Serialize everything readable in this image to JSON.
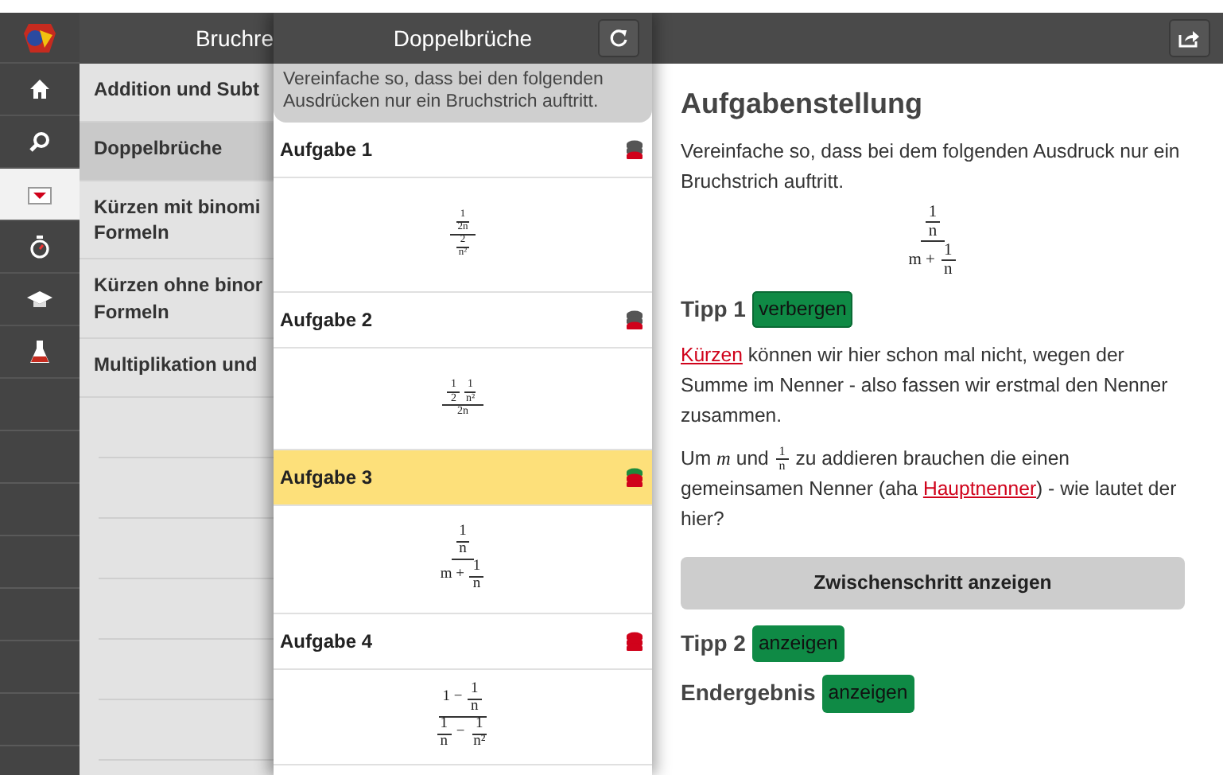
{
  "rail": [
    {
      "kind": "home",
      "selected": false
    },
    {
      "kind": "search",
      "selected": false
    },
    {
      "kind": "tray",
      "selected": true
    },
    {
      "kind": "stopwatch",
      "selected": false
    },
    {
      "kind": "cap",
      "selected": false
    },
    {
      "kind": "flask",
      "selected": false
    }
  ],
  "sidebar": {
    "title": "Bruchre",
    "items": [
      {
        "label": "Addition und Subt",
        "selected": false
      },
      {
        "label": "Doppelbrüche",
        "selected": true
      },
      {
        "label": "Kürzen mit binomi\nFormeln",
        "selected": false
      },
      {
        "label": "Kürzen ohne binor\nFormeln",
        "selected": false
      },
      {
        "label": "Multiplikation und",
        "selected": false
      }
    ]
  },
  "list_panel": {
    "title": "Doppelbrüche",
    "instruction": "Vereinfache so, dass bei den folgenden Ausdrücken nur ein Bruchstrich auftritt.",
    "items": [
      {
        "label": "Aufgabe 1",
        "selected": false,
        "layers": [
          {
            "color": "#555555"
          },
          {
            "color": "#555555"
          },
          {
            "color": "#d0021b"
          }
        ],
        "formula": [
          {
            "num": [
              {
                "num": [
                  "1"
                ],
                "den": [
                  "2n"
                ]
              }
            ],
            "den": [
              {
                "num": [
                  "2"
                ],
                "den": [
                  "n²"
                ]
              }
            ]
          }
        ]
      },
      {
        "label": "Aufgabe 2",
        "selected": false,
        "layers": [
          {
            "color": "#555555"
          },
          {
            "color": "#555555"
          },
          {
            "color": "#d0021b"
          }
        ],
        "formula": [
          {
            "num": [
              {
                "num": [
                  "1"
                ],
                "den": [
                  "2"
                ]
              },
              {
                "num": [
                  "1"
                ],
                "den": [
                  "n²"
                ]
              }
            ],
            "den": [
              "2n"
            ]
          }
        ]
      },
      {
        "label": "Aufgabe 3",
        "selected": true,
        "layers": [
          {
            "color": "#1e8a3c"
          },
          {
            "color": "#d0021b"
          },
          {
            "color": "#d0021b"
          }
        ],
        "formula": [
          {
            "num": [
              {
                "num": [
                  "1"
                ],
                "den": [
                  "n"
                ]
              }
            ],
            "den": [
              "m + ",
              {
                "num": [
                  "1"
                ],
                "den": [
                  "n"
                ]
              }
            ]
          }
        ]
      },
      {
        "label": "Aufgabe 4",
        "selected": false,
        "layers": [
          {
            "color": "#d0021b"
          },
          {
            "color": "#d0021b"
          },
          {
            "color": "#d0021b"
          }
        ],
        "formula": [
          {
            "num": [
              "1 − ",
              {
                "num": [
                  "1"
                ],
                "den": [
                  "n"
                ]
              }
            ],
            "den": [
              {
                "num": [
                  "1"
                ],
                "den": [
                  "n"
                ]
              },
              " − ",
              {
                "num": [
                  "1"
                ],
                "den": [
                  "n²"
                ]
              }
            ]
          }
        ]
      }
    ]
  },
  "detail": {
    "heading": "Aufgabenstellung",
    "text": "Vereinfache so, dass bei dem folgenden Ausdruck nur ein Bruchstrich auftritt.",
    "formula": [
      {
        "num": [
          {
            "num": [
              "1"
            ],
            "den": [
              "n"
            ]
          }
        ],
        "den": [
          "m + ",
          {
            "num": [
              "1"
            ],
            "den": [
              "n"
            ]
          }
        ]
      }
    ],
    "tips": [
      {
        "label": "Tipp 1",
        "button": "verbergen",
        "expanded": true,
        "paragraphs": [
          [
            {
              "kind": "link",
              "text": "Kürzen"
            },
            {
              "kind": "text",
              "text": " können wir hier schon mal nicht, wegen der Summe im Nenner - also fassen wir erstmal den Nenner zusammen."
            }
          ],
          [
            {
              "kind": "text",
              "text": "Um "
            },
            {
              "kind": "math",
              "text": "m"
            },
            {
              "kind": "text",
              "text": " und "
            },
            {
              "kind": "frac",
              "num": "1",
              "den": "n"
            },
            {
              "kind": "text",
              "text": " zu addieren brauchen die einen gemeinsamen Nenner (aha "
            },
            {
              "kind": "link",
              "text": "Hauptnenner"
            },
            {
              "kind": "text",
              "text": ") - wie lautet der hier?"
            }
          ]
        ],
        "step_button": "Zwischenschritt anzeigen"
      },
      {
        "label": "Tipp 2",
        "button": "anzeigen",
        "expanded": false
      },
      {
        "label": "Endergebnis",
        "button": "anzeigen",
        "expanded": false
      }
    ]
  }
}
